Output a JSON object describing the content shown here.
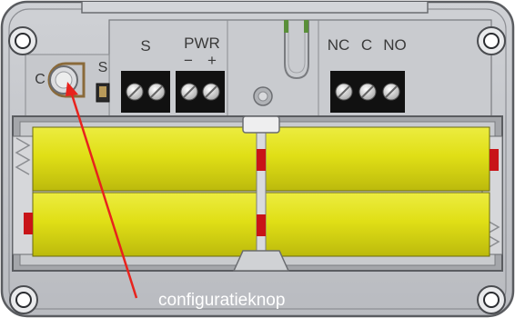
{
  "terminals": {
    "s_label": "S",
    "pwr_label": "PWR",
    "pwr_minus": "−",
    "pwr_plus": "+",
    "nc_label": "NC",
    "c_label": "C",
    "no_label": "NO"
  },
  "config": {
    "c_label": "C",
    "s_label": "S"
  },
  "callout": {
    "text": "configuratieknop"
  },
  "colors": {
    "housing": "#c4c6cb",
    "housing_dark": "#5a5c60",
    "battery": "#dede12",
    "battery_shade": "#b9b70c",
    "terminal_block": "#111111",
    "screw": "#d9d9d9",
    "contact_red": "#c81418",
    "arrow": "#e8231d",
    "text": "#ffffff"
  }
}
